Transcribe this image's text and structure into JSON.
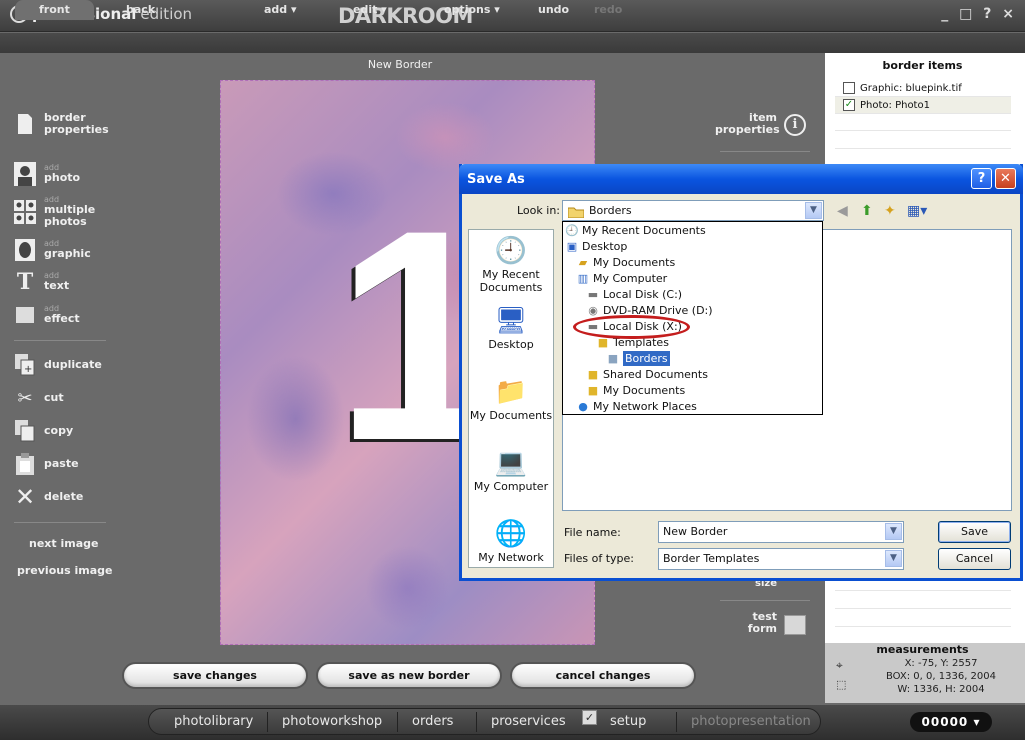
{
  "app": {
    "brand_bold": "professional",
    "brand_light": "edition",
    "name": "DARKROOM",
    "window_controls": "_ □ ? ×"
  },
  "menu": {
    "front": "front",
    "back": "back",
    "add": "add ▾",
    "edit": "edit ▾",
    "options": "options ▾",
    "undo": "undo",
    "redo": "redo"
  },
  "document": {
    "title": "New Border",
    "big_number": "1"
  },
  "left_toolbar": {
    "border_properties": "border properties",
    "add_small": "add",
    "photo": "photo",
    "multiple_photos": "multiple photos",
    "graphic": "graphic",
    "text": "text",
    "effect": "effect",
    "duplicate": "duplicate",
    "cut": "cut",
    "copy": "copy",
    "paste": "paste",
    "delete": "delete",
    "next_image": "next image",
    "previous_image": "previous image"
  },
  "right_toolbar": {
    "item_properties": "item properties",
    "size": "size",
    "test_form": "test form"
  },
  "border_items": {
    "title": "border items",
    "items": [
      {
        "label": "Graphic: bluepink.tif",
        "checked": false
      },
      {
        "label": "Photo: Photo1",
        "checked": true
      }
    ]
  },
  "measurements": {
    "title": "measurements",
    "xy": "X: -75, Y: 2557",
    "box": "BOX: 0, 0, 1336, 2004",
    "wh": "W: 1336, H: 2004"
  },
  "bottom_buttons": {
    "save_changes": "save changes",
    "save_as_new_border": "save as new border",
    "cancel_changes": "cancel changes"
  },
  "bottom_nav": {
    "items": [
      "photolibrary",
      "photoworkshop",
      "orders",
      "proservices",
      "setup",
      "photopresentation"
    ],
    "counter": "00000 ▾"
  },
  "dialog": {
    "title": "Save As",
    "help": "?",
    "close": "✕",
    "look_in_label": "Look in:",
    "look_in_value": "Borders",
    "places": [
      "My Recent Documents",
      "Desktop",
      "My Documents",
      "My Computer",
      "My Network"
    ],
    "tree": [
      {
        "label": "My Recent Documents",
        "icon": "recent-documents-icon"
      },
      {
        "label": "Desktop",
        "icon": "desktop-icon"
      },
      {
        "label": "My Documents",
        "icon": "documents-folder-icon"
      },
      {
        "label": "My Computer",
        "icon": "computer-icon"
      },
      {
        "label": "Local Disk (C:)",
        "icon": "hard-disk-icon"
      },
      {
        "label": "DVD-RAM Drive (D:)",
        "icon": "dvd-drive-icon"
      },
      {
        "label": "Local Disk (X:)",
        "icon": "hard-disk-icon"
      },
      {
        "label": "Templates",
        "icon": "folder-icon"
      },
      {
        "label": "Borders",
        "icon": "open-folder-icon",
        "selected": true
      },
      {
        "label": "Shared Documents",
        "icon": "folder-icon"
      },
      {
        "label": "My Documents",
        "icon": "folder-icon"
      },
      {
        "label": "My Network Places",
        "icon": "network-places-icon"
      }
    ],
    "file_name_label": "File name:",
    "file_name_value": "New Border",
    "file_type_label": "Files of type:",
    "file_type_value": "Border Templates",
    "save": "Save",
    "cancel": "Cancel"
  }
}
